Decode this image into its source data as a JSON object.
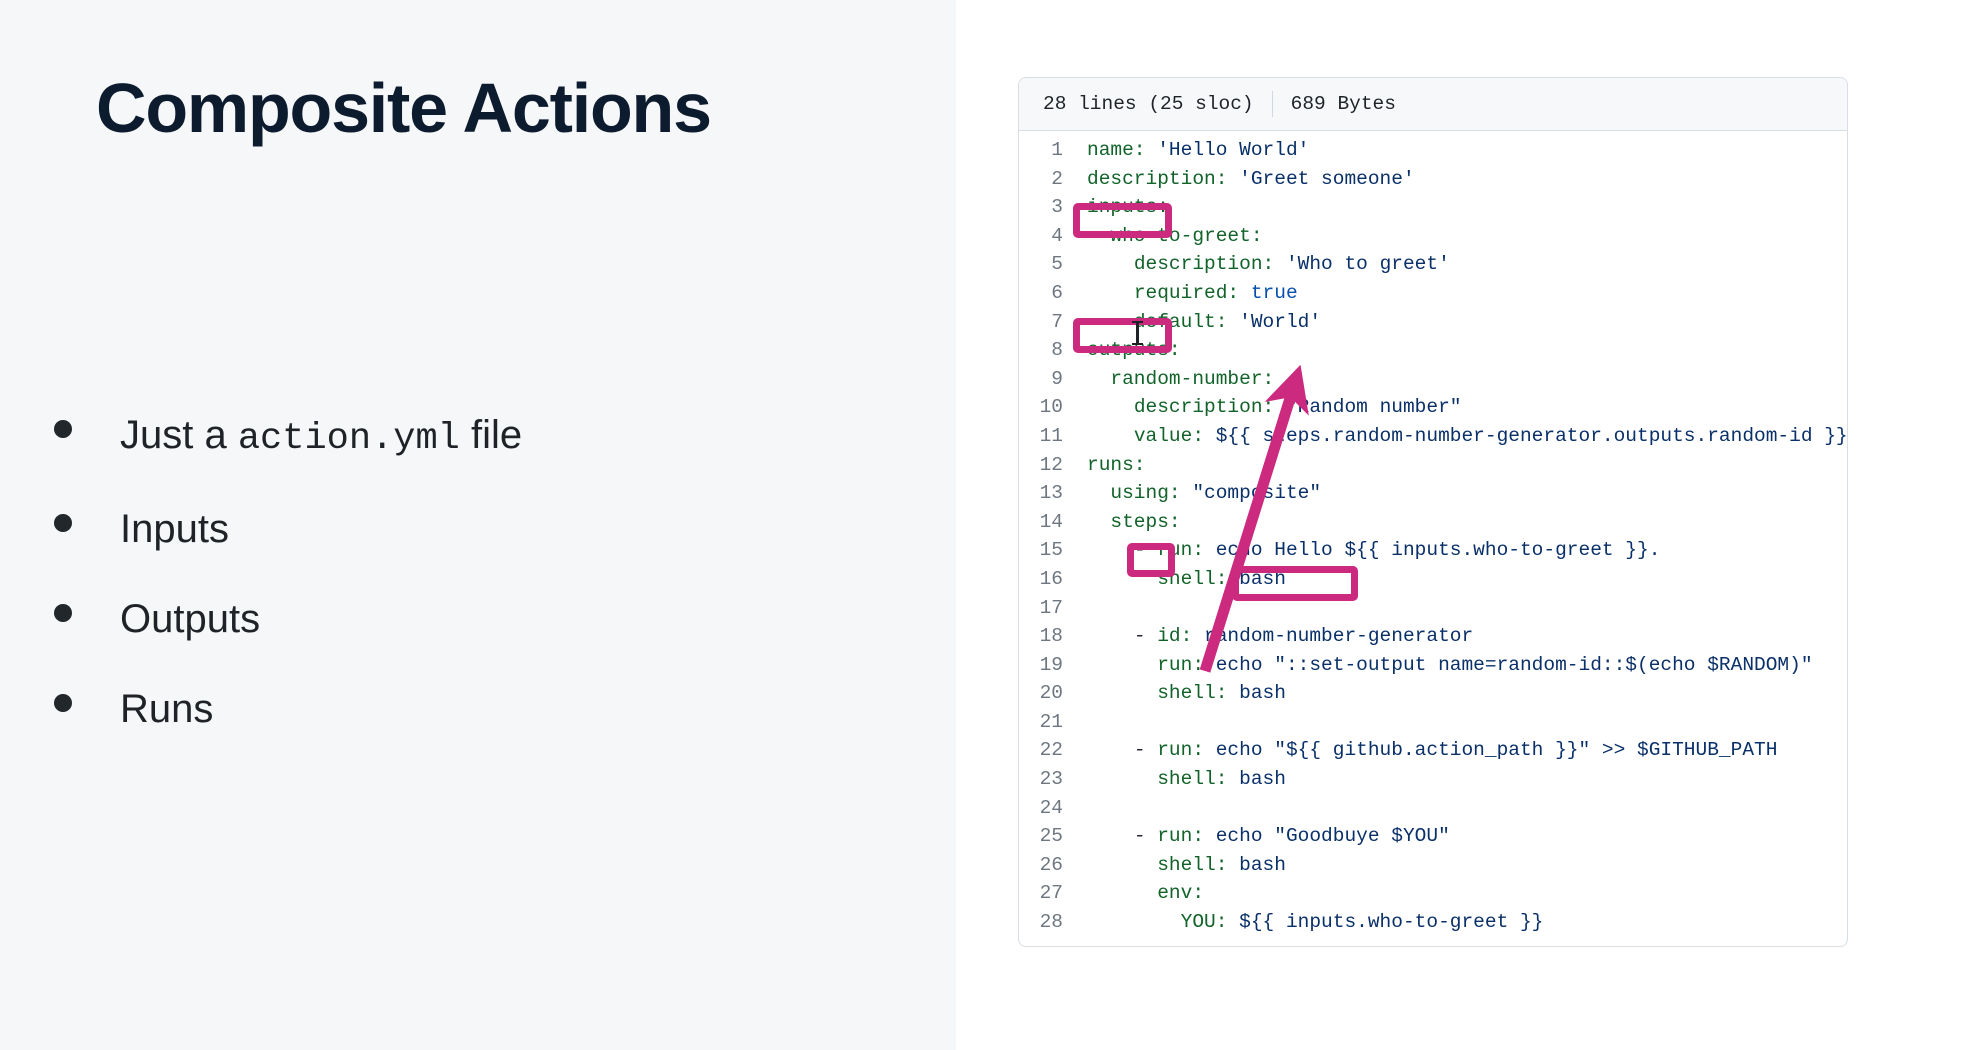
{
  "slide": {
    "title": "Composite Actions",
    "bullets": [
      {
        "text_before": "Just a ",
        "code": "action.yml",
        "text_after": " file"
      },
      {
        "text_before": "Inputs",
        "code": "",
        "text_after": ""
      },
      {
        "text_before": "Outputs",
        "code": "",
        "text_after": ""
      },
      {
        "text_before": "Runs",
        "code": "",
        "text_after": ""
      }
    ]
  },
  "code_viewer": {
    "header": {
      "lines_label": "28 lines (25 sloc)",
      "size_label": "689 Bytes"
    },
    "lines": [
      {
        "n": "1",
        "text": "name: 'Hello World'"
      },
      {
        "n": "2",
        "text": "description: 'Greet someone'"
      },
      {
        "n": "3",
        "text": "inputs:"
      },
      {
        "n": "4",
        "text": "  who-to-greet:"
      },
      {
        "n": "5",
        "text": "    description: 'Who to greet'"
      },
      {
        "n": "6",
        "text": "    required: true"
      },
      {
        "n": "7",
        "text": "    default: 'World'"
      },
      {
        "n": "8",
        "text": "outputs:"
      },
      {
        "n": "9",
        "text": "  random-number:"
      },
      {
        "n": "10",
        "text": "    description: \"Random number\""
      },
      {
        "n": "11",
        "text": "    value: ${{ steps.random-number-generator.outputs.random-id }}"
      },
      {
        "n": "12",
        "text": "runs:"
      },
      {
        "n": "13",
        "text": "  using: \"composite\""
      },
      {
        "n": "14",
        "text": "  steps:"
      },
      {
        "n": "15",
        "text": "    - run: echo Hello ${{ inputs.who-to-greet }}."
      },
      {
        "n": "16",
        "text": "      shell: bash"
      },
      {
        "n": "17",
        "text": ""
      },
      {
        "n": "18",
        "text": "    - id: random-number-generator"
      },
      {
        "n": "19",
        "text": "      run: echo \"::set-output name=random-id::$(echo $RANDOM)\""
      },
      {
        "n": "20",
        "text": "      shell: bash"
      },
      {
        "n": "21",
        "text": ""
      },
      {
        "n": "22",
        "text": "    - run: echo \"${{ github.action_path }}\" >> $GITHUB_PATH"
      },
      {
        "n": "23",
        "text": "      shell: bash"
      },
      {
        "n": "24",
        "text": ""
      },
      {
        "n": "25",
        "text": "    - run: echo \"Goodbuye $YOU\""
      },
      {
        "n": "26",
        "text": "      shell: bash"
      },
      {
        "n": "27",
        "text": "      env:"
      },
      {
        "n": "28",
        "text": "        YOU: ${{ inputs.who-to-greet }}"
      }
    ]
  },
  "annotations": {
    "accent_color": "#cc2a7f",
    "highlights": [
      {
        "label": "inputs:",
        "line": "3"
      },
      {
        "label": "outputs:",
        "line": "8"
      },
      {
        "label": "id:",
        "line": "18"
      },
      {
        "label": "::set-output",
        "line": "19"
      }
    ],
    "arrow": {
      "from_label": "::set-output",
      "to_label": "steps.random-number-generator.outputs.random-id"
    }
  },
  "colors": {
    "left_panel_bg": "#f5f7f9",
    "right_panel_bg": "#ffffff",
    "title_color": "#0d1b2e",
    "code_key": "#116329",
    "code_string": "#0a3069",
    "code_bool": "#0550ae",
    "line_number": "#6e7781",
    "card_border": "#d8dee4",
    "card_header_bg": "#f6f8fa"
  }
}
